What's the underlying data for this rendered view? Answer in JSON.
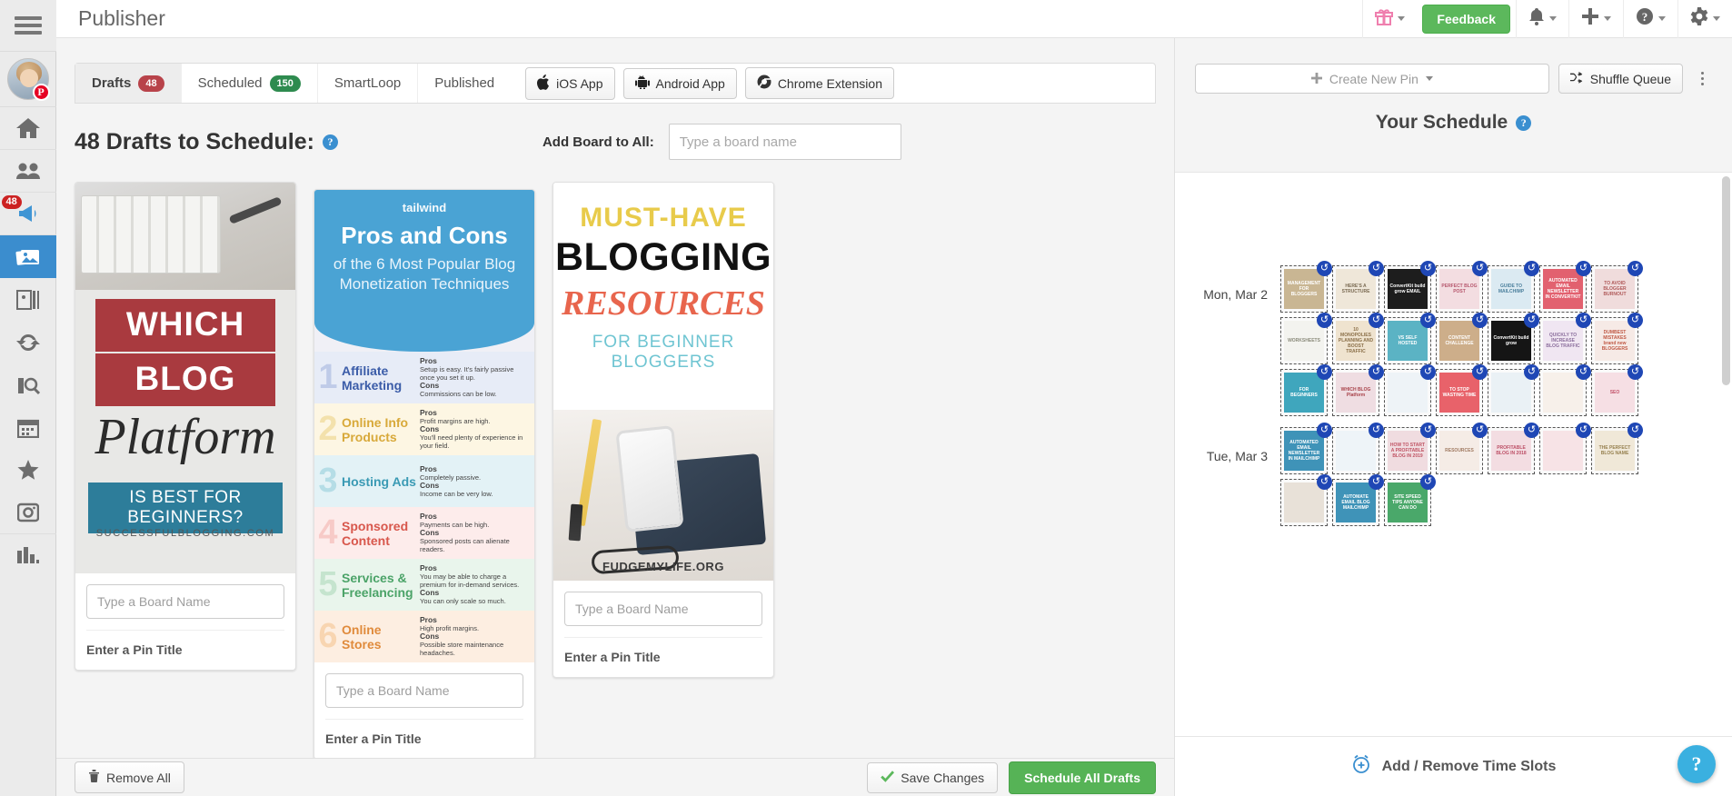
{
  "app": {
    "title": "Publisher"
  },
  "topbar": {
    "feedback_label": "Feedback",
    "icons": [
      "gift-icon",
      "bell-icon",
      "plus-icon",
      "question-icon",
      "gear-icon"
    ]
  },
  "sidebar": {
    "items": [
      {
        "name": "home-icon",
        "label": "Home"
      },
      {
        "name": "people-icon",
        "label": "Tribes"
      },
      {
        "name": "megaphone-icon",
        "label": "Promotions",
        "badge": "48"
      },
      {
        "name": "photos-icon",
        "label": "Publisher",
        "active": true
      },
      {
        "name": "pinboard-icon",
        "label": "Boards"
      },
      {
        "name": "refresh-icon",
        "label": "SmartLoop"
      },
      {
        "name": "insights-icon",
        "label": "Insights"
      },
      {
        "name": "calendar-icon",
        "label": "Calendar"
      },
      {
        "name": "star-icon",
        "label": "Favorites"
      },
      {
        "name": "instagram-icon",
        "label": "Instagram"
      },
      {
        "name": "analytics-icon",
        "label": "Analytics"
      }
    ],
    "avatar_badge": "P"
  },
  "tabs": [
    {
      "label": "Drafts",
      "count": "48",
      "count_color": "#b8434a",
      "active": true
    },
    {
      "label": "Scheduled",
      "count": "150",
      "count_color": "#2e8b4f",
      "active": false
    },
    {
      "label": "SmartLoop",
      "count": "",
      "active": false
    },
    {
      "label": "Published",
      "count": "",
      "active": false
    }
  ],
  "app_buttons": [
    {
      "label": "iOS App",
      "icon": "apple-icon"
    },
    {
      "label": "Android App",
      "icon": "android-icon"
    },
    {
      "label": "Chrome Extension",
      "icon": "chrome-icon"
    }
  ],
  "drafts": {
    "heading": "48 Drafts to Schedule:",
    "help": "?",
    "add_board_label": "Add Board to All:",
    "add_board_placeholder": "Type a board name",
    "add_board_value": ""
  },
  "cards": [
    {
      "board_placeholder": "Type a Board Name",
      "pin_title_placeholder": "Enter a Pin Title",
      "art": {
        "line1": "WHICH",
        "line2": "BLOG",
        "line3": "Platform",
        "line4": "IS BEST FOR BEGINNERS?",
        "site": "SUCCESSFULBLOGGING.COM"
      }
    },
    {
      "board_placeholder": "Type a Board Name",
      "pin_title_placeholder": "Enter a Pin Title",
      "art": {
        "brand": "tailwind",
        "title": "Pros and Cons",
        "subtitle": "of the 6 Most Popular Blog Monetization Techniques",
        "rows": [
          {
            "num": "1",
            "label": "Affiliate Marketing",
            "pros": "Setup is easy. It's fairly passive once you set it up.",
            "cons": "Commissions can be low.",
            "bg": "#e7ecf7",
            "numColor": "#8fa4d6",
            "labelColor": "#3b5ca8"
          },
          {
            "num": "2",
            "label": "Online Info Products",
            "pros": "Profit margins are high.",
            "cons": "You'll need plenty of experience in your field.",
            "bg": "#fdf6e3",
            "numColor": "#e8c86a",
            "labelColor": "#d8a93a"
          },
          {
            "num": "3",
            "label": "Hosting Ads",
            "pros": "Completely passive.",
            "cons": "Income can be very low.",
            "bg": "#e3f2f6",
            "numColor": "#7fc4d4",
            "labelColor": "#3a9ab4"
          },
          {
            "num": "4",
            "label": "Sponsored Content",
            "pros": "Payments can be high.",
            "cons": "Sponsored posts can alienate readers.",
            "bg": "#fdeceb",
            "numColor": "#f0a39c",
            "labelColor": "#d8574c"
          },
          {
            "num": "5",
            "label": "Services & Freelancing",
            "pros": "You may be able to charge a premium for in-demand services.",
            "cons": "You can only scale so much.",
            "bg": "#e9f5ec",
            "numColor": "#9ad0ab",
            "labelColor": "#4ba368"
          },
          {
            "num": "6",
            "label": "Online Stores",
            "pros": "High profit margins.",
            "cons": "Possible store maintenance headaches.",
            "bg": "#fdeee1",
            "numColor": "#f3b978",
            "labelColor": "#e08b3c"
          }
        ]
      }
    },
    {
      "board_placeholder": "Type a Board Name",
      "pin_title_placeholder": "Enter a Pin Title",
      "art": {
        "line1": "MUST-HAVE",
        "line2": "BLOGGING",
        "line3": "RESOURCES",
        "line4": "FOR BEGINNER",
        "line5": "BLOGGERS",
        "url": "FUDGEMYLIFE.ORG"
      }
    }
  ],
  "action_bar": {
    "remove_all": "Remove All",
    "save_changes": "Save Changes",
    "schedule_all": "Schedule All Drafts"
  },
  "schedule": {
    "create_pin_label": "Create New Pin",
    "shuffle_label": "Shuffle Queue",
    "title": "Your Schedule",
    "help": "?",
    "timeslots_label": "Add / Remove Time Slots",
    "help_fab": "?",
    "days": [
      {
        "label": "Mon, Mar 2",
        "slots": [
          {
            "text": "MANAGEMENT FOR BLOGGERS",
            "bg": "#c9b693",
            "color": "#ffffff",
            "loop": true
          },
          {
            "text": "HERE'S A STRUCTURE",
            "bg": "#efe7d9",
            "color": "#7a6a52",
            "loop": true
          },
          {
            "text": "ConvertKit build grow EMAIL",
            "bg": "#1d1d1d",
            "color": "#ffffff",
            "loop": true
          },
          {
            "text": "PERFECT BLOG POST",
            "bg": "#f3dde1",
            "color": "#b6566c",
            "loop": true
          },
          {
            "text": "GUIDE TO MAILCHIMP",
            "bg": "#dbeaf2",
            "color": "#4b7f9c",
            "loop": true
          },
          {
            "text": "AUTOMATED EMAIL NEWSLETTER IN CONVERTKIT",
            "bg": "#e2616f",
            "color": "#ffffff",
            "loop": true
          },
          {
            "text": "TO AVOID BLOGGER BURNOUT",
            "bg": "#f0dcdc",
            "color": "#b05a5a",
            "loop": true
          },
          {
            "text": "WORKSHEETS",
            "bg": "#f3f3ef",
            "color": "#8a8a7a",
            "loop": true
          },
          {
            "text": "10 MONOPOLIES PLANNING AND BOOST TRAFFIC",
            "bg": "#efe3cf",
            "color": "#8a6f48",
            "loop": true
          },
          {
            "text": "VS SELF HOSTED",
            "bg": "#5bb3c4",
            "color": "#ffffff",
            "loop": true
          },
          {
            "text": "CONTENT CHALLENGE",
            "bg": "#cdae8a",
            "color": "#ffffff",
            "loop": true
          },
          {
            "text": "ConvertKit build grow",
            "bg": "#151515",
            "color": "#ffffff",
            "loop": true
          },
          {
            "text": "QUICKLY TO INCREASE BLOG TRAFFIC",
            "bg": "#f0e6f2",
            "color": "#8b6e9c",
            "loop": true
          },
          {
            "text": "DUMBEST MISTAKES brand new BLOGGERS",
            "bg": "#f6eae6",
            "color": "#c05a46",
            "loop": true
          },
          {
            "text": "FOR BEGINNERS",
            "bg": "#3fa6bd",
            "color": "#ffffff",
            "loop": true
          },
          {
            "text": "WHICH BLOG Platform",
            "bg": "#efdde2",
            "color": "#a8424a",
            "loop": true
          },
          {
            "text": "",
            "bg": "#eef3f7",
            "color": "#6f93ab",
            "loop": true
          },
          {
            "text": "TO STOP WASTING TIME",
            "bg": "#e8626a",
            "color": "#ffffff",
            "loop": true
          },
          {
            "text": "",
            "bg": "#eaf1f5",
            "color": "#6f93ab",
            "loop": true
          },
          {
            "text": "",
            "bg": "#f7f0ea",
            "color": "#b09a84",
            "loop": true
          },
          {
            "text": "SEO",
            "bg": "#f6dfe4",
            "color": "#c3536b",
            "loop": true
          }
        ]
      },
      {
        "label": "Tue, Mar 3",
        "slots": [
          {
            "text": "AUTOMATED EMAIL NEWSLETTER IN MAILCHIMP",
            "bg": "#3f93b8",
            "color": "#ffffff",
            "loop": true
          },
          {
            "text": "",
            "bg": "#eef4f8",
            "color": "#5d93b0",
            "loop": true
          },
          {
            "text": "HOW TO START A PROFITABLE BLOG IN 2019",
            "bg": "#f0dce0",
            "color": "#c05464",
            "loop": true
          },
          {
            "text": "RESOURCES",
            "bg": "#f5ece6",
            "color": "#a07a62",
            "loop": true
          },
          {
            "text": "PROFITABLE BLOG IN 2018",
            "bg": "#f3dde2",
            "color": "#bd5067",
            "loop": true
          },
          {
            "text": "",
            "bg": "#f7e3e6",
            "color": "#c36a78",
            "loop": true
          },
          {
            "text": "THE PERFECT BLOG NAME",
            "bg": "#f0e8d8",
            "color": "#96804f",
            "loop": true
          },
          {
            "text": "",
            "bg": "#e8e1d8",
            "color": "#7b6a58",
            "loop": true
          },
          {
            "text": "AUTOMATE EMAIL BLOG MAILCHIMP",
            "bg": "#3f93b8",
            "color": "#ffffff",
            "loop": true
          },
          {
            "text": "SITE SPEED TIPS ANYONE CAN DO",
            "bg": "#4aa86a",
            "color": "#ffffff",
            "loop": true
          }
        ]
      }
    ]
  }
}
